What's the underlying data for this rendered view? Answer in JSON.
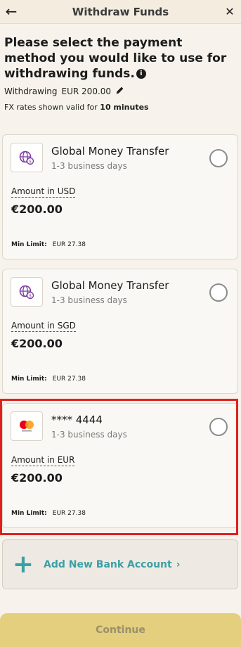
{
  "header": {
    "back_icon": "←",
    "title": "Withdraw Funds",
    "close_icon": "✕"
  },
  "intro": {
    "heading": "Please select the payment method you would like to use for withdrawing funds.",
    "info_icon": "i",
    "withdrawing_label": "Withdrawing",
    "withdrawing_value": "EUR 200.00",
    "fx_prefix": "FX rates shown valid for",
    "fx_duration": "10 minutes"
  },
  "methods": [
    {
      "name": "Global Money Transfer",
      "days": "1-3 business days",
      "amount_label": "Amount in USD",
      "amount": "€200.00",
      "min_label": "Min Limit:",
      "min_value": "EUR 27.38",
      "icon": "globe-money-icon"
    },
    {
      "name": "Global Money Transfer",
      "days": "1-3 business days",
      "amount_label": "Amount in SGD",
      "amount": "€200.00",
      "min_label": "Min Limit:",
      "min_value": "EUR 27.38",
      "icon": "globe-money-icon"
    },
    {
      "name": "**** 4444",
      "days": "1-3 business days",
      "amount_label": "Amount in EUR",
      "amount": "€200.00",
      "min_label": "Min Limit:",
      "min_value": "EUR 27.38",
      "icon": "mastercard-icon"
    }
  ],
  "add_bank": {
    "plus_icon": "+",
    "label": "Add New Bank Account",
    "chevron": "›"
  },
  "continue_label": "Continue",
  "colors": {
    "accent": "#3aa0a5",
    "highlight": "#e02020",
    "button": "#e3cf7d",
    "globe": "#7b3fa0"
  }
}
